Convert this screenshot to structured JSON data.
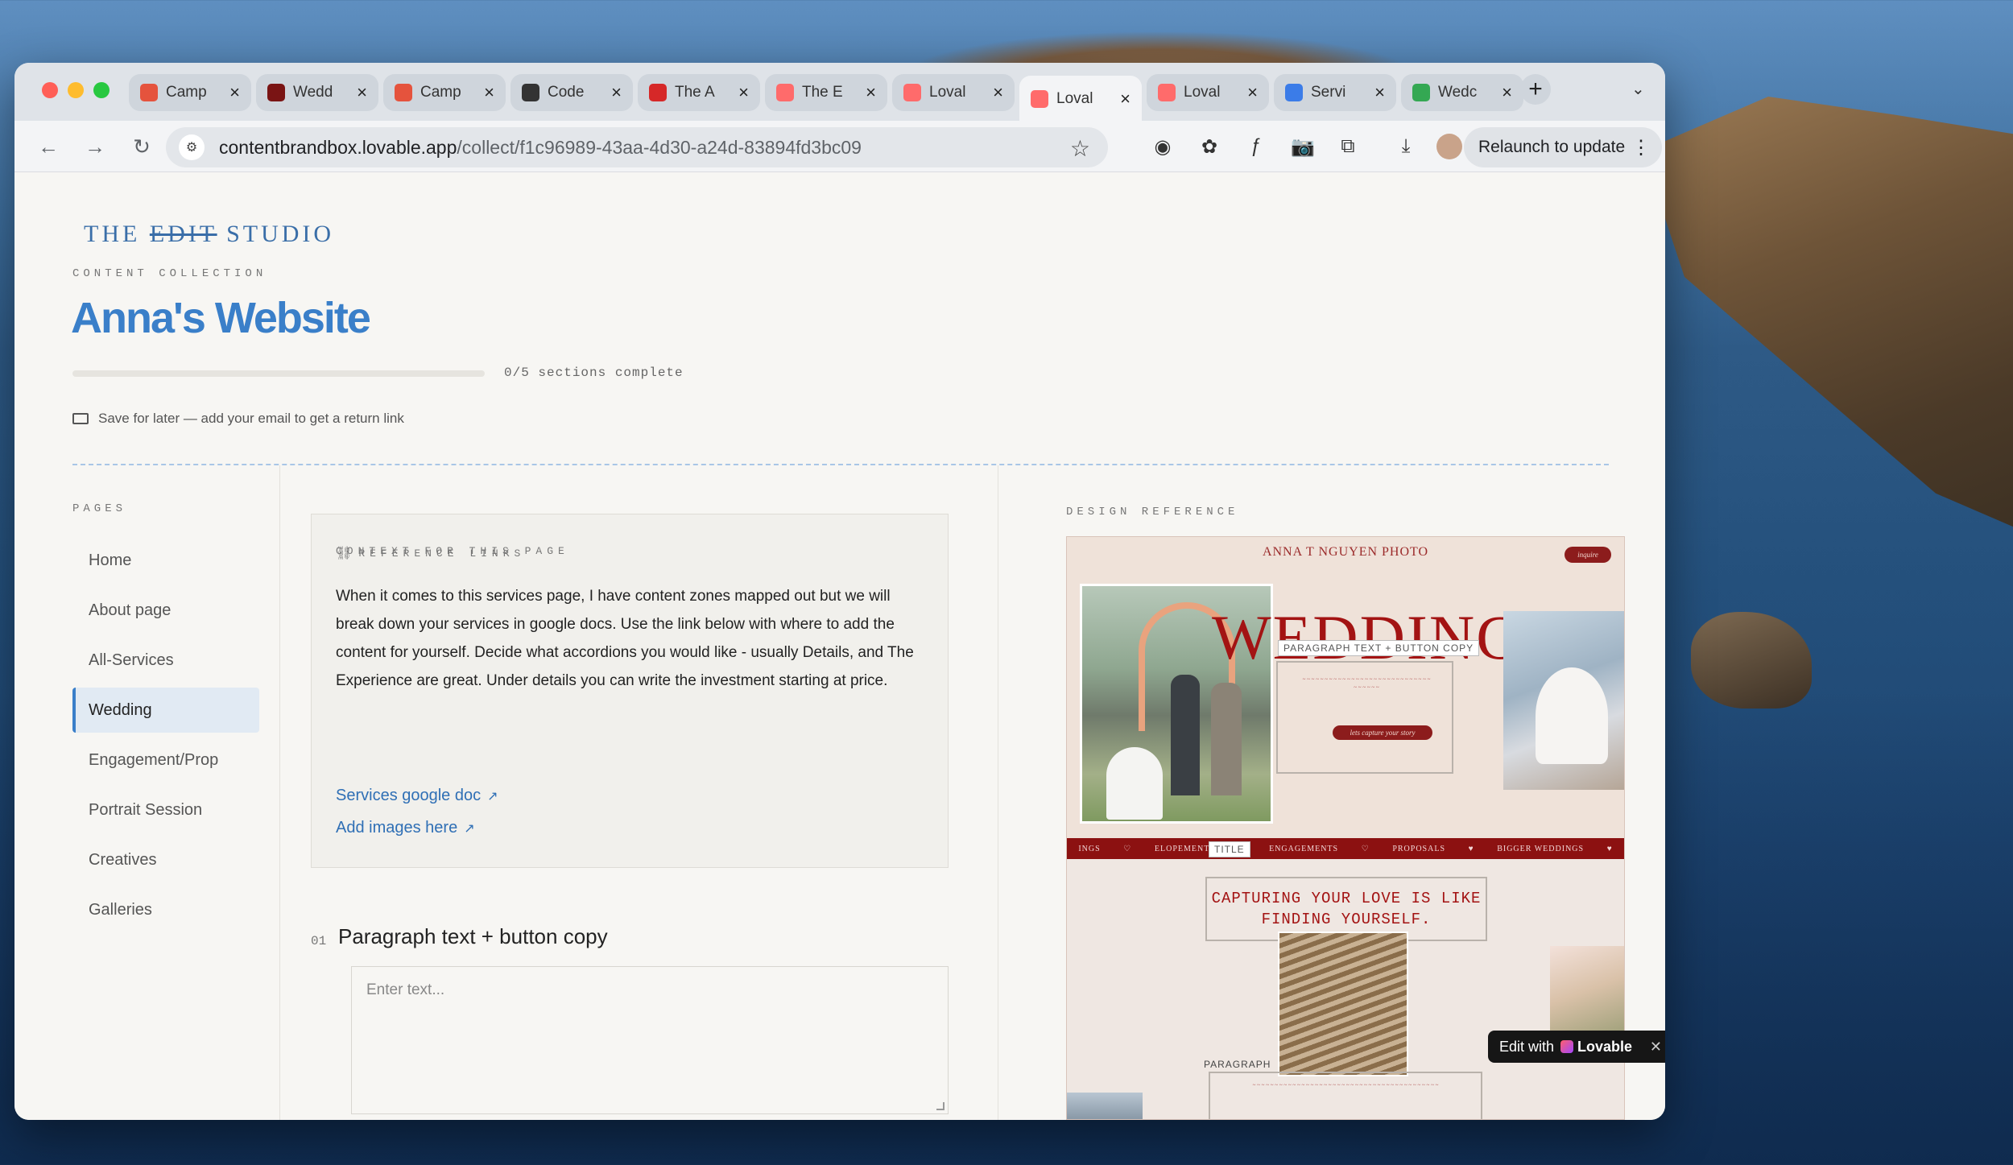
{
  "browser": {
    "tabs": [
      {
        "title": "Camp",
        "icon": "sparkle-icon",
        "color": "#e5533d",
        "active": false
      },
      {
        "title": "Wedd",
        "icon": "anthropic-icon",
        "color": "#7a1414",
        "active": false
      },
      {
        "title": "Camp",
        "icon": "sparkle-icon",
        "color": "#e5533d",
        "active": false
      },
      {
        "title": "Code",
        "icon": "gear-icon",
        "color": "#333333",
        "active": false
      },
      {
        "title": "The A",
        "icon": "brush-icon",
        "color": "#d62828",
        "active": false
      },
      {
        "title": "The E",
        "icon": "lovable-heart-icon",
        "color": "#ff6b6b",
        "active": false
      },
      {
        "title": "Loval",
        "icon": "lovable-heart-icon",
        "color": "#ff6b6b",
        "active": false
      },
      {
        "title": "Loval",
        "icon": "lovable-heart-icon",
        "color": "#ff6b6b",
        "active": true
      },
      {
        "title": "Loval",
        "icon": "lovable-heart-icon",
        "color": "#ff6b6b",
        "active": false
      },
      {
        "title": "Servi",
        "icon": "google-docs-icon",
        "color": "#3b7ce8",
        "active": false
      },
      {
        "title": "Wedc",
        "icon": "google-drive-icon",
        "color": "#34a853",
        "active": false
      }
    ],
    "url_host": "contentbrandbox.lovable.app",
    "url_path": "/collect/f1c96989-43aa-4d30-a24d-83894fd3bc09",
    "relaunch_label": "Relaunch to update"
  },
  "page": {
    "logo": {
      "word1": "THE",
      "word2": "EDIT",
      "word3": "STUDIO"
    },
    "collection_label": "CONTENT COLLECTION",
    "title": "Anna's Website",
    "progress": {
      "completed": 0,
      "total": 5,
      "text": "0/5 sections complete"
    },
    "save_later": "Save for later — add your email to get a return link",
    "accent_color": "#3a7fc9"
  },
  "sidebar": {
    "label": "PAGES",
    "items": [
      {
        "label": "Home",
        "active": false
      },
      {
        "label": "About page",
        "active": false
      },
      {
        "label": "All-Services",
        "active": false
      },
      {
        "label": "Wedding",
        "active": true
      },
      {
        "label": "Engagement/Prop",
        "active": false
      },
      {
        "label": "Portrait Session",
        "active": false
      },
      {
        "label": "Creatives",
        "active": false
      },
      {
        "label": "Galleries",
        "active": false
      }
    ]
  },
  "context": {
    "label": "CONTEXT FOR THIS PAGE",
    "text": "When it comes to this services page, I have content zones mapped out but we will break down your services in google docs. Use the link below with where to add the content for yourself. Decide what accordions you would like - usually Details, and The Experience are great. Under details you can write the investment starting at price.",
    "reference_label": "REFERENCE LINKS",
    "links": [
      {
        "label": "Services google doc"
      },
      {
        "label": "Add images here"
      }
    ]
  },
  "section": {
    "number": "01",
    "title": "Paragraph text + button copy",
    "placeholder": "Enter text..."
  },
  "design_reference": {
    "label": "DESIGN REFERENCE",
    "brand": "ANNA T NGUYEN PHOTO",
    "pill": "inquire",
    "headline": "WEDDINGS",
    "tag_paragraph_button": "PARAGRAPH TEXT + BUTTON COPY",
    "cta": "lets capture your story",
    "band_items": [
      "INGS",
      "♡",
      "ELOPEMENTS",
      "♡",
      "ENGAGEMENTS",
      "♡",
      "PROPOSALS",
      "♥",
      "BIGGER WEDDINGS",
      "♥"
    ],
    "tag_title": "TITLE",
    "quote": "CAPTURING YOUR LOVE IS LIKE FINDING YOURSELF.",
    "tag_paragraph": "PARAGRAPH"
  },
  "lovable_badge": {
    "prefix": "Edit with",
    "brand": "Lovable"
  }
}
